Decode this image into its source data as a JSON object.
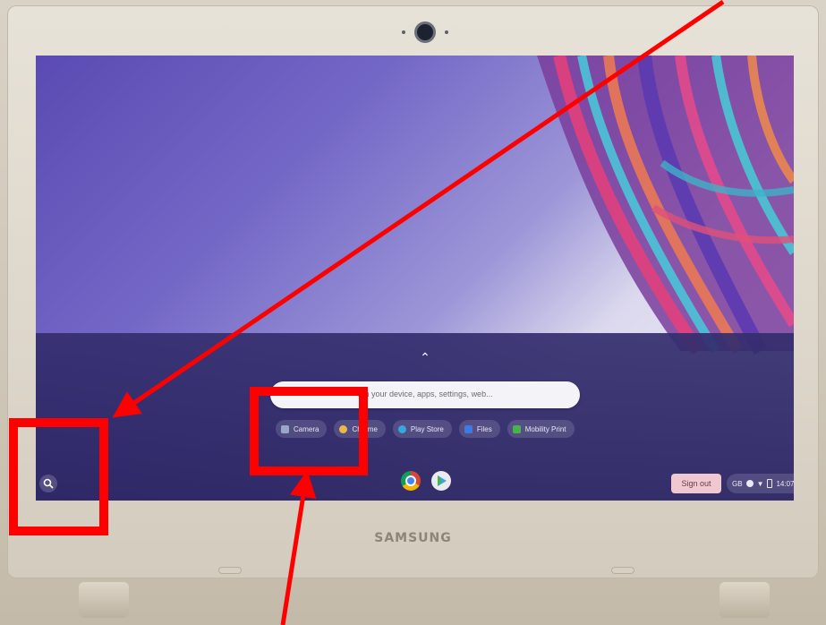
{
  "device": {
    "brand": "SAMSUNG"
  },
  "launcher": {
    "search_placeholder": "Search your device, apps, settings, web...",
    "search_visible_text": "rch your device, apps, settings, web...",
    "apps": [
      {
        "label": "Camera",
        "icon": "camera-icon",
        "color": "#9aa6c8"
      },
      {
        "label": "Chrome",
        "icon": "chrome-icon",
        "color": "#e8b84a"
      },
      {
        "label": "Play Store",
        "icon": "play-store-icon",
        "color": "#35a8e0"
      },
      {
        "label": "Files",
        "icon": "files-icon",
        "color": "#3c7be0"
      },
      {
        "label": "Mobility Print",
        "icon": "mobility-print-icon",
        "color": "#48b24f"
      }
    ]
  },
  "shelf": {
    "pinned_apps": [
      {
        "name": "chrome-icon",
        "color": "#e8b84a"
      },
      {
        "name": "play-store-icon",
        "color": "#35a8e0"
      }
    ],
    "sign_out_label": "Sign out",
    "keyboard_layout": "GB",
    "time": "14:07"
  },
  "colors": {
    "annotation": "#ff0000"
  }
}
